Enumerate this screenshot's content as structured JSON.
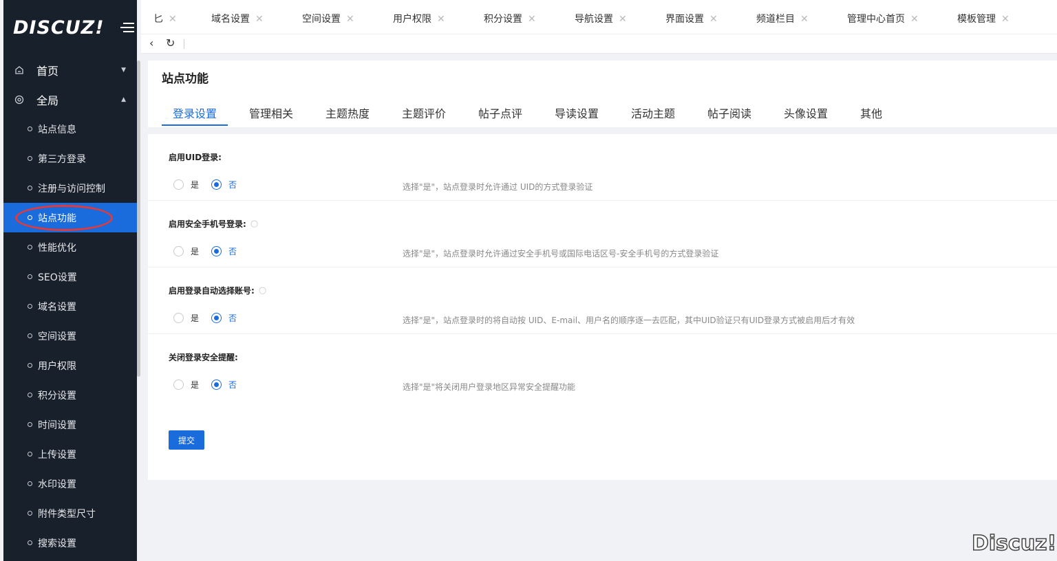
{
  "brand": {
    "logo": "DISCUZ!",
    "watermark": "Discuz!"
  },
  "sidebar": {
    "top_items": [
      {
        "label": "首页",
        "icon": "home-icon",
        "arrow": "▼"
      },
      {
        "label": "全局",
        "icon": "gear-icon",
        "arrow": "▲"
      }
    ],
    "sub_items": [
      {
        "label": "站点信息"
      },
      {
        "label": "第三方登录"
      },
      {
        "label": "注册与访问控制"
      },
      {
        "label": "站点功能",
        "active": true
      },
      {
        "label": "性能优化"
      },
      {
        "label": "SEO设置"
      },
      {
        "label": "域名设置"
      },
      {
        "label": "空间设置"
      },
      {
        "label": "用户权限"
      },
      {
        "label": "积分设置"
      },
      {
        "label": "时间设置"
      },
      {
        "label": "上传设置"
      },
      {
        "label": "水印设置"
      },
      {
        "label": "附件类型尺寸"
      },
      {
        "label": "搜索设置"
      }
    ]
  },
  "tabs": [
    {
      "label": "匕"
    },
    {
      "label": "域名设置"
    },
    {
      "label": "空间设置"
    },
    {
      "label": "用户权限"
    },
    {
      "label": "积分设置"
    },
    {
      "label": "导航设置"
    },
    {
      "label": "界面设置"
    },
    {
      "label": "频道栏目"
    },
    {
      "label": "管理中心首页"
    },
    {
      "label": "模板管理"
    }
  ],
  "page": {
    "title": "站点功能",
    "subtabs": [
      "登录设置",
      "管理相关",
      "主题热度",
      "主题评价",
      "帖子点评",
      "导读设置",
      "活动主题",
      "帖子阅读",
      "头像设置",
      "其他"
    ],
    "active_subtab": "登录设置"
  },
  "form": {
    "yes_label": "是",
    "no_label": "否",
    "rows": [
      {
        "label": "启用UID登录:",
        "help": false,
        "value": "否",
        "tip": "选择\"是\"，站点登录时允许通过 UID的方式登录验证"
      },
      {
        "label": "启用安全手机号登录:",
        "help": true,
        "value": "否",
        "tip": "选择\"是\"，站点登录时允许通过安全手机号或国际电话区号-安全手机号的方式登录验证"
      },
      {
        "label": "启用登录自动选择账号:",
        "help": true,
        "value": "否",
        "tip": "选择\"是\"，站点登录时的将自动按 UID、E-mail、用户名的顺序逐一去匹配，其中UID验证只有UID登录方式被启用后才有效"
      },
      {
        "label": "关闭登录安全提醒:",
        "help": false,
        "value": "否",
        "tip": "选择\"是\"将关闭用户登录地区异常安全提醒功能"
      }
    ],
    "submit_label": "提交"
  },
  "colors": {
    "accent": "#1a6bdc",
    "sidebar_bg": "#18202c",
    "annotation": "#e23a3a"
  }
}
